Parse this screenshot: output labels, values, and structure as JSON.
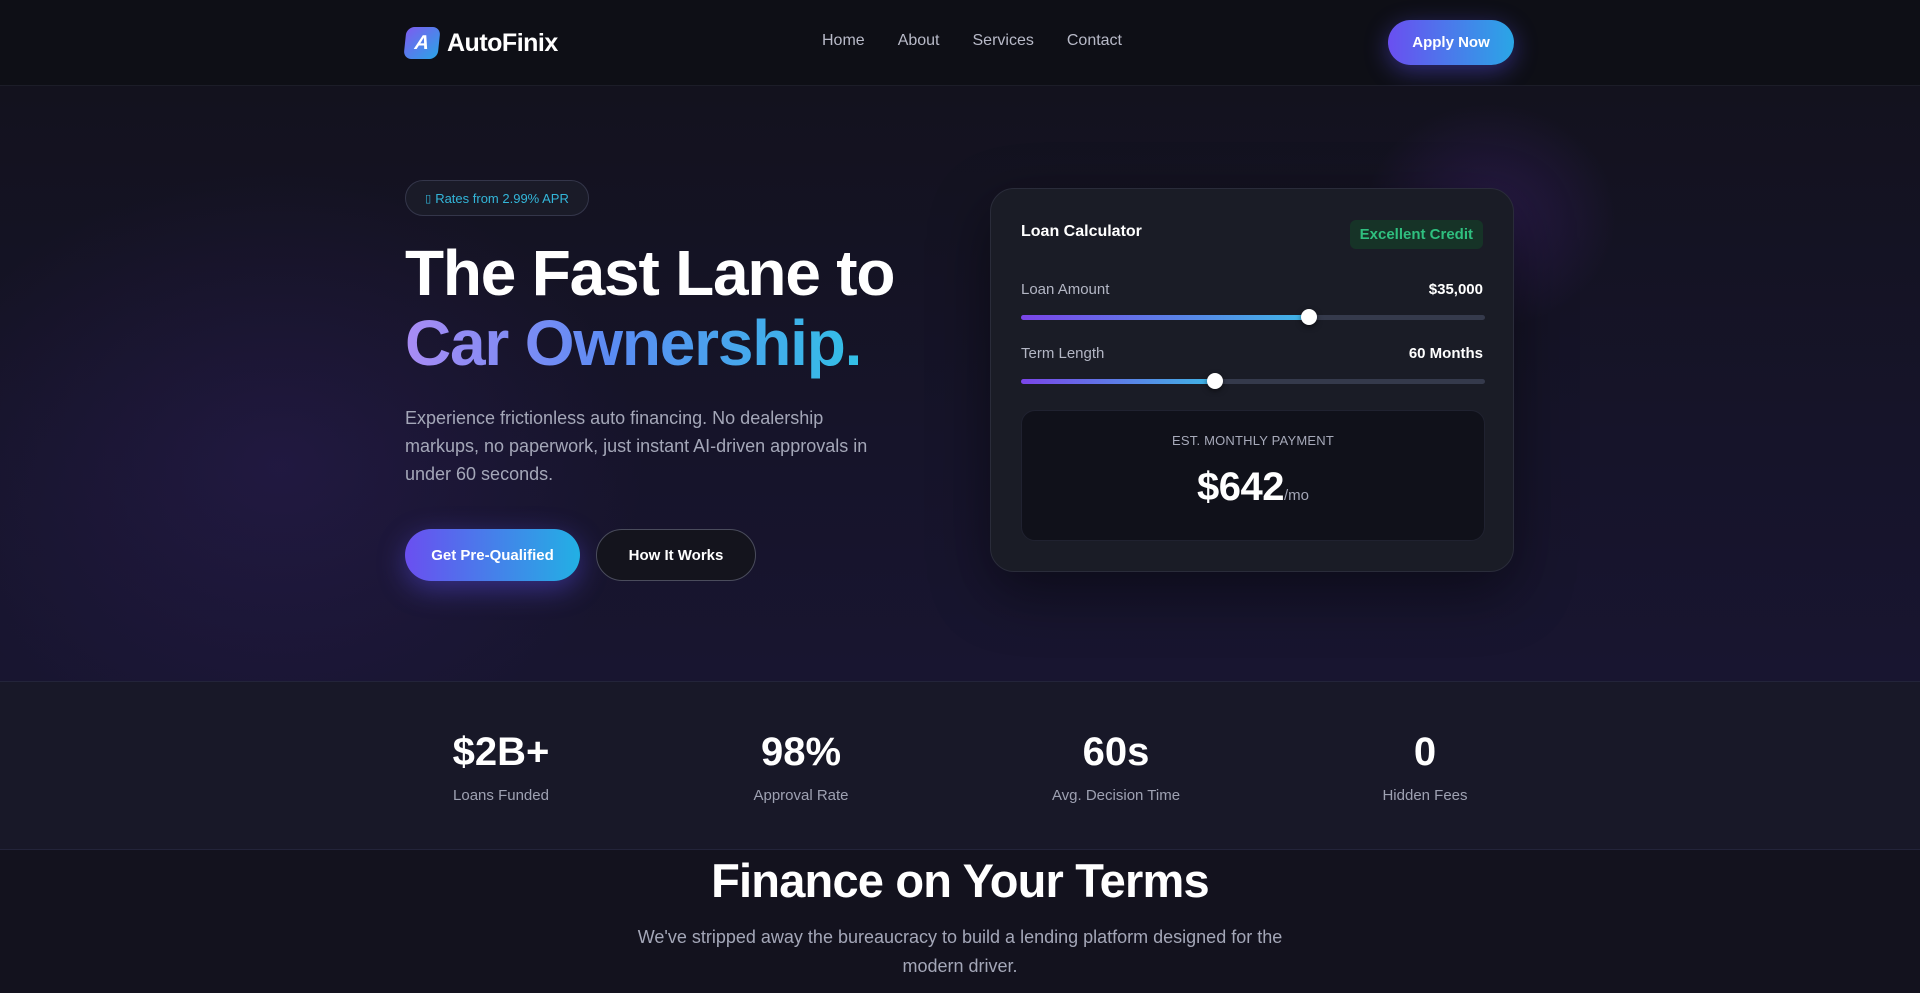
{
  "brand": {
    "logo_letter": "A",
    "name": "AutoFinix"
  },
  "nav": {
    "links": [
      "Home",
      "About",
      "Services",
      "Contact"
    ],
    "cta": "Apply Now"
  },
  "hero": {
    "pill_icon": "spark-icon",
    "pill_text": "Rates from 2.99% APR",
    "title_line1": "The Fast Lane to",
    "title_line2": "Car Ownership.",
    "subtitle": "Experience frictionless auto financing. No dealership markups, no paperwork, just instant AI-driven approvals in under 60 seconds.",
    "primary_button": "Get Pre-Qualified",
    "secondary_button": "How It Works"
  },
  "calculator": {
    "title": "Loan Calculator",
    "badge": "Excellent Credit",
    "loan_amount_label": "Loan Amount",
    "loan_amount_value": "$35,000",
    "loan_amount_fraction": 0.62,
    "term_label": "Term Length",
    "term_value": "60 Months",
    "term_fraction": 0.418,
    "payment_label": "EST. MONTHLY PAYMENT",
    "payment_amount": "$642",
    "payment_unit": "/mo"
  },
  "stats": [
    {
      "value": "$2B+",
      "label": "Loans Funded"
    },
    {
      "value": "98%",
      "label": "Approval Rate"
    },
    {
      "value": "60s",
      "label": "Avg. Decision Time"
    },
    {
      "value": "0",
      "label": "Hidden Fees"
    }
  ],
  "finance": {
    "title": "Finance on Your Terms",
    "subtitle": "We've stripped away the bureaucracy to build a lending platform designed for the modern driver."
  },
  "colors": {
    "accent_purple": "#6a4ff0",
    "accent_cyan": "#22b0e4",
    "badge_green": "#2fbf7f",
    "background": "#0f1018"
  }
}
